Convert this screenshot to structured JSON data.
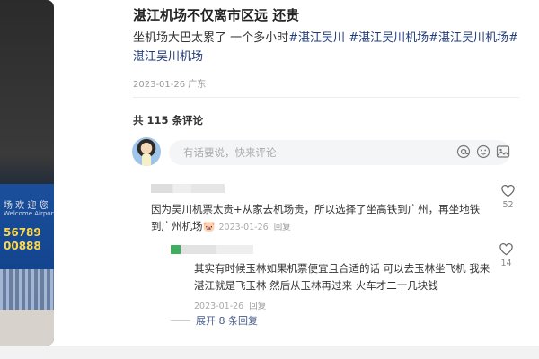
{
  "photo": {
    "sign_line1": "场 欢 迎 您",
    "sign_line1_sub": "Welcome Airport",
    "sign_line2": "56789",
    "sign_line3": "00888"
  },
  "post": {
    "title": "湛江机场不仅离市区远 还贵",
    "body_text": "坐机场大巴太累了 一个多小时",
    "hashtags": [
      "#湛江吴川",
      "#湛江吴川机场",
      "#湛江吴川机场",
      "#湛江吴川机场"
    ],
    "date_location": "2023-01-26 广东"
  },
  "comments_section": {
    "count_label": "共 115 条评论",
    "input_placeholder": "有话要说，快来评论",
    "icons": [
      "at-icon",
      "emoji-icon",
      "image-icon"
    ]
  },
  "comments": [
    {
      "text": "因为吴川机票太贵+从家去机场贵，所以选择了坐高铁到广州，再坐地铁到广州机场",
      "emoji": "🐷",
      "date": "2023-01-26",
      "reply_label": "回复",
      "likes": "52"
    }
  ],
  "reply": {
    "text": "其实有时候玉林如果机票便宜且合适的话 可以去玉林坐飞机 我来湛江就是飞玉林 然后从玉林再过来 火车才二十几块钱",
    "date": "2023-01-26",
    "reply_label": "回复",
    "likes": "14"
  },
  "expand_label": "展开 8 条回复",
  "colors": {
    "hashtag": "#213b7a",
    "muted": "#999999",
    "input_bg": "#f4f5f7"
  }
}
